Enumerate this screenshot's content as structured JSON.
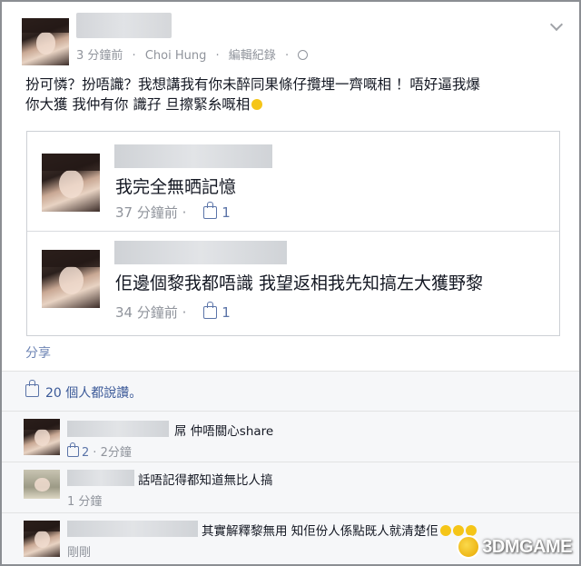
{
  "post": {
    "time": "3 分鐘前",
    "separator1": "·",
    "location": "Choi Hung",
    "separator2": "·",
    "edit_history": "編輯紀錄",
    "separator3": "·",
    "text_line1": "扮可憐？扮唔識？我想講我有你未醉同果條仔攬埋一齊嘅相 ！唔好逼我爆",
    "text_line2": "你大獲 我仲有你  識孖   旦擦緊糸嘅相"
  },
  "shared_comments": [
    {
      "text": "我完全無晒記憶",
      "time": "37 分鐘前",
      "separator": "·",
      "likes": "1"
    },
    {
      "text": "佢邊個黎我都唔識 我望返相我先知搞左大獲野黎",
      "time": "34 分鐘前",
      "separator": "·",
      "likes": "1"
    }
  ],
  "share_label": "分享",
  "likes_summary": "20 個人都說讚。",
  "comments": [
    {
      "text": "屌 仲唔關心share",
      "likes": "2",
      "separator": "·",
      "time": "2分鐘"
    },
    {
      "text": "話唔記得都知道無比人搞",
      "time": "1 分鐘"
    },
    {
      "text": "其實解釋黎無用 知佢份人係點既人就清楚佢",
      "time": "剛剛"
    }
  ],
  "watermark": {
    "text": "3DMGAME"
  },
  "icons": {
    "chevron": "chevron-down-icon",
    "globe": "globe-icon",
    "like": "thumbs-up-icon",
    "emoji": "emoji-icon"
  },
  "colors": {
    "link": "#3b5998",
    "meta": "#90949c",
    "like_blue": "#5b74a8",
    "ufi_bg": "#f6f7f9"
  }
}
